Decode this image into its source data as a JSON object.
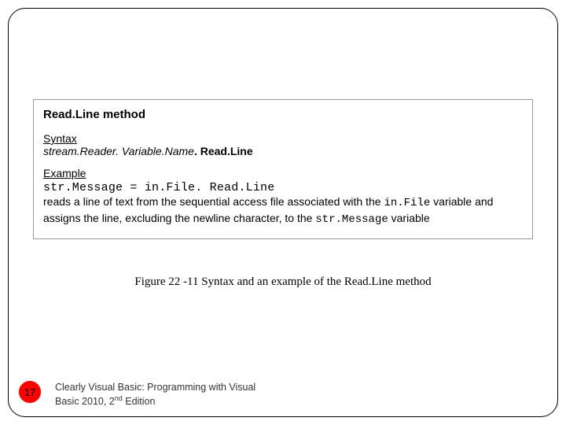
{
  "panel": {
    "title": "Read.Line method",
    "syntax_heading": "Syntax",
    "syntax_prefix": "stream.Reader. Variable.Name",
    "syntax_bold": ". Read.Line",
    "example_heading": "Example",
    "example_code": "str.Message = in.File. Read.Line",
    "example_desc_1": "reads a line of text from the sequential access file associated with the ",
    "example_desc_var1": "in.File",
    "example_desc_2": " variable and assigns the line, excluding the newline character, to the ",
    "example_desc_var2": "str.Message",
    "example_desc_3": " variable"
  },
  "caption": "Figure 22 -11 Syntax and an example of the Read.Line method",
  "page_number": "17",
  "footer": {
    "line1": "Clearly Visual Basic: Programming with Visual",
    "line2a": "Basic 2010, 2",
    "line2sup": "nd",
    "line2b": " Edition"
  }
}
